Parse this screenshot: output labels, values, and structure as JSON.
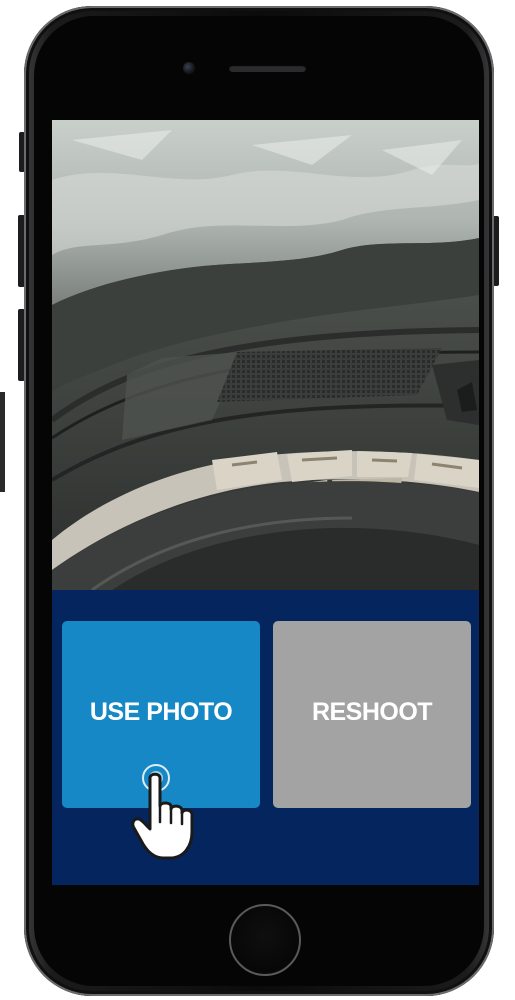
{
  "screen": {
    "photo": {
      "subject": "tire-sidewall-photo"
    },
    "actions": {
      "use_photo_label": "USE PHOTO",
      "reshoot_label": "RESHOOT"
    }
  },
  "colors": {
    "screen_background": "#04255e",
    "use_photo_button": "#1688c6",
    "reshoot_button": "#a3a3a3",
    "button_text": "#ffffff"
  },
  "icons": {
    "pointer": "hand-pointer-icon",
    "home": "home-button"
  }
}
